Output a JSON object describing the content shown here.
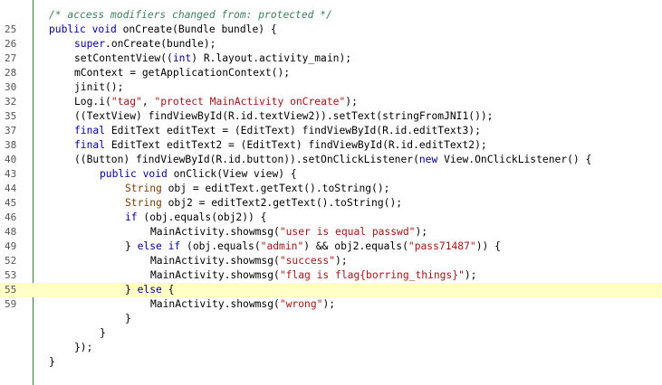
{
  "editor": {
    "lines": [
      {
        "num": "",
        "indent": 0,
        "tokens": [
          {
            "t": "cmt",
            "v": "/* access modifiers changed from: protected */"
          }
        ]
      },
      {
        "num": "25",
        "indent": 0,
        "tokens": [
          {
            "t": "kw",
            "v": "public void "
          },
          {
            "t": "",
            "v": "onCreate(Bundle bundle) {"
          }
        ]
      },
      {
        "num": "26",
        "indent": 1,
        "tokens": [
          {
            "t": "kw",
            "v": "super"
          },
          {
            "t": "",
            "v": ".onCreate(bundle);"
          }
        ]
      },
      {
        "num": "27",
        "indent": 1,
        "tokens": [
          {
            "t": "",
            "v": "setContentView(("
          },
          {
            "t": "kw",
            "v": "int"
          },
          {
            "t": "",
            "v": ") R.layout.activity_main);"
          }
        ]
      },
      {
        "num": "28",
        "indent": 1,
        "tokens": [
          {
            "t": "",
            "v": "mContext = getApplicationContext();"
          }
        ]
      },
      {
        "num": "30",
        "indent": 1,
        "tokens": [
          {
            "t": "",
            "v": "jinit();"
          }
        ]
      },
      {
        "num": "32",
        "indent": 1,
        "tokens": [
          {
            "t": "",
            "v": "Log.i("
          },
          {
            "t": "str",
            "v": "\"tag\""
          },
          {
            "t": "",
            "v": ", "
          },
          {
            "t": "str",
            "v": "\"protect MainActivity onCreate\""
          },
          {
            "t": "",
            "v": ");"
          }
        ]
      },
      {
        "num": "35",
        "indent": 1,
        "tokens": [
          {
            "t": "",
            "v": "((TextView) findViewById(R.id.textView2)).setText(stringFromJNI1());"
          }
        ]
      },
      {
        "num": "37",
        "indent": 1,
        "tokens": [
          {
            "t": "kw",
            "v": "final "
          },
          {
            "t": "",
            "v": "EditText editText = (EditText) findViewById(R.id.editText3);"
          }
        ]
      },
      {
        "num": "38",
        "indent": 1,
        "tokens": [
          {
            "t": "kw",
            "v": "final "
          },
          {
            "t": "",
            "v": "EditText editText2 = (EditText) findViewById(R.id.editText2);"
          }
        ]
      },
      {
        "num": "40",
        "indent": 1,
        "tokens": [
          {
            "t": "",
            "v": "((Button) findViewById(R.id.button)).setOnClickListener("
          },
          {
            "t": "kw",
            "v": "new "
          },
          {
            "t": "",
            "v": "View.OnClickListener() {"
          }
        ]
      },
      {
        "num": "43",
        "indent": 2,
        "tokens": [
          {
            "t": "kw",
            "v": "public void "
          },
          {
            "t": "",
            "v": "onClick(View view) {"
          }
        ]
      },
      {
        "num": "44",
        "indent": 3,
        "tokens": [
          {
            "t": "typ",
            "v": "String "
          },
          {
            "t": "",
            "v": "obj = editText.getText().toString();"
          }
        ]
      },
      {
        "num": "45",
        "indent": 3,
        "tokens": [
          {
            "t": "typ",
            "v": "String "
          },
          {
            "t": "",
            "v": "obj2 = editText2.getText().toString();"
          }
        ]
      },
      {
        "num": "46",
        "indent": 3,
        "tokens": [
          {
            "t": "kw",
            "v": "if "
          },
          {
            "t": "",
            "v": "(obj.equals(obj2)) {"
          }
        ]
      },
      {
        "num": "48",
        "indent": 4,
        "tokens": [
          {
            "t": "",
            "v": "MainActivity.showmsg("
          },
          {
            "t": "str",
            "v": "\"user is equal passwd\""
          },
          {
            "t": "",
            "v": ");"
          }
        ]
      },
      {
        "num": "49",
        "indent": 3,
        "tokens": [
          {
            "t": "",
            "v": "} "
          },
          {
            "t": "kw",
            "v": "else if "
          },
          {
            "t": "",
            "v": "(obj.equals("
          },
          {
            "t": "str",
            "v": "\"admin\""
          },
          {
            "t": "",
            "v": ") && obj2.equals("
          },
          {
            "t": "str",
            "v": "\"pass71487\""
          },
          {
            "t": "",
            "v": ")) {"
          }
        ]
      },
      {
        "num": "52",
        "indent": 4,
        "tokens": [
          {
            "t": "",
            "v": "MainActivity.showmsg("
          },
          {
            "t": "str",
            "v": "\"success\""
          },
          {
            "t": "",
            "v": ");"
          }
        ]
      },
      {
        "num": "53",
        "indent": 4,
        "tokens": [
          {
            "t": "",
            "v": "MainActivity.showmsg("
          },
          {
            "t": "str",
            "v": "\"flag is flag{borring_things}\""
          },
          {
            "t": "",
            "v": ");"
          }
        ]
      },
      {
        "num": "55",
        "indent": 3,
        "highlight": true,
        "tokens": [
          {
            "t": "",
            "v": "} "
          },
          {
            "t": "kw",
            "v": "else "
          },
          {
            "t": "",
            "v": "{"
          }
        ]
      },
      {
        "num": "59",
        "indent": 4,
        "tokens": [
          {
            "t": "",
            "v": "MainActivity.showmsg("
          },
          {
            "t": "str",
            "v": "\"wrong\""
          },
          {
            "t": "",
            "v": ");"
          }
        ]
      },
      {
        "num": "",
        "indent": 3,
        "tokens": [
          {
            "t": "",
            "v": "}"
          }
        ]
      },
      {
        "num": "",
        "indent": 2,
        "tokens": [
          {
            "t": "",
            "v": "}"
          }
        ]
      },
      {
        "num": "",
        "indent": 1,
        "tokens": [
          {
            "t": "",
            "v": "});"
          }
        ]
      },
      {
        "num": "",
        "indent": 0,
        "tokens": [
          {
            "t": "",
            "v": "}"
          }
        ]
      }
    ]
  },
  "colors": {
    "keyword": "#00009a",
    "string": "#a31515",
    "comment": "#3f7f5f",
    "highlight_line": "#ffffc8",
    "gutter_border": "#3b7a3b"
  }
}
